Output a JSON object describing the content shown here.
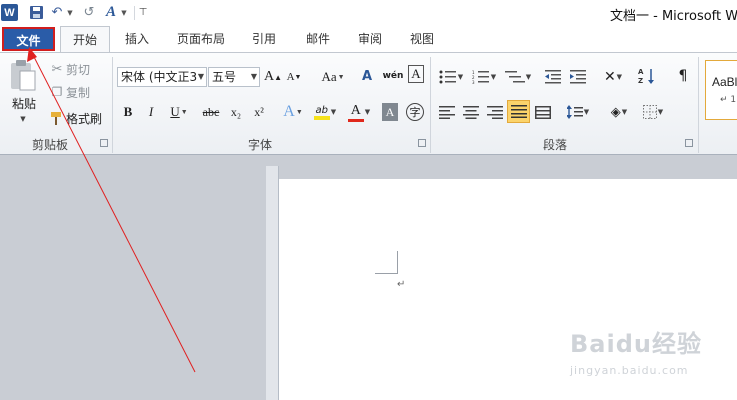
{
  "window": {
    "title": "文档一 - Microsoft Word"
  },
  "qat": {
    "logo": "W",
    "undo": "↶",
    "redo": "↺",
    "spell": "A",
    "customize": "⊤"
  },
  "tabs": [
    {
      "label": "文件"
    },
    {
      "label": "开始"
    },
    {
      "label": "插入"
    },
    {
      "label": "页面布局"
    },
    {
      "label": "引用"
    },
    {
      "label": "邮件"
    },
    {
      "label": "审阅"
    },
    {
      "label": "视图"
    }
  ],
  "clipboard": {
    "paste_label": "粘贴",
    "cut_label": "剪切",
    "copy_label": "复制",
    "format_painter_label": "格式刷",
    "group_label": "剪贴板"
  },
  "font": {
    "font_name": "宋体 (中文正3",
    "font_size": "五号",
    "group_label": "字体",
    "grow_label": "A",
    "shrink_label": "A",
    "case_label": "Aa",
    "clear_label": "A",
    "pinyin_label": "wén",
    "bold": "B",
    "italic": "I",
    "underline": "U",
    "strike": "abc",
    "subscript": "x₂",
    "superscript": "x²",
    "effects": "A",
    "highlight": "ab",
    "color": "A",
    "shading": "A",
    "enclose": "字"
  },
  "paragraph": {
    "group_label": "段落"
  },
  "styles": {
    "preview_top": "AaBl",
    "preview_bottom": "↵ 1"
  },
  "watermark": {
    "brand": "Baidu经验",
    "url": "jingyan.baidu.com"
  },
  "document": {
    "paragraph_mark": "↵"
  },
  "colors": {
    "file_tab_bg": "#2a5ca8",
    "annotation_red": "#d11e1e",
    "highlight_yellow": "#f5e21c",
    "font_color_red": "#e0281c"
  }
}
